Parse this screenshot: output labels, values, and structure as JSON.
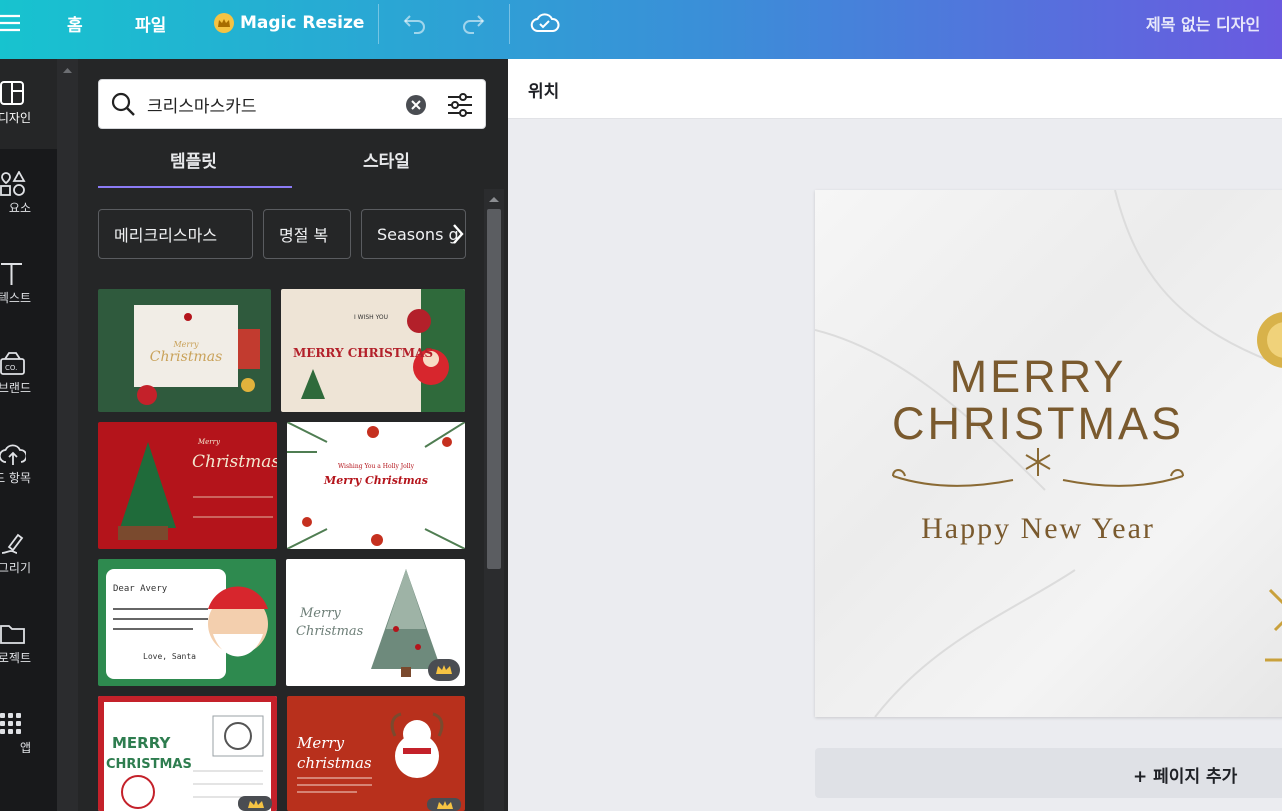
{
  "topbar": {
    "home": "홈",
    "file": "파일",
    "magic_resize": "Magic Resize",
    "title": "제목 없는 디자인"
  },
  "rail": [
    {
      "label": "디자인",
      "icon": "layout-icon"
    },
    {
      "label": "요소",
      "icon": "shapes-icon"
    },
    {
      "label": "텍스트",
      "icon": "text-icon"
    },
    {
      "label": "브랜드",
      "icon": "brand-icon"
    },
    {
      "label": "업로드 항목",
      "icon": "upload-icon"
    },
    {
      "label": "그리기",
      "icon": "draw-icon"
    },
    {
      "label": "프로젝트",
      "icon": "folder-icon"
    },
    {
      "label": "앱",
      "icon": "apps-icon"
    }
  ],
  "search": {
    "value": "크리스마스카드"
  },
  "tabs": {
    "templates": "템플릿",
    "styles": "스타일"
  },
  "chips": [
    "메리크리스마스",
    "명절 복",
    "Seasons g"
  ],
  "templates": [
    {
      "line1": "Merry",
      "line2": "Christmas",
      "bg": "#2f5a3d",
      "card": "#f1ede6",
      "accent": "#c9a25a"
    },
    {
      "line1": "I WISH YOU",
      "line2": "MERRY CHRISTMAS",
      "bg": "#eee4d6",
      "card": "#eee4d6",
      "accent": "#b3202a"
    },
    {
      "line1": "Merry",
      "line2": "Christmas",
      "bg": "#b4141b",
      "card": "#b4141b",
      "accent": "#f3e7d0"
    },
    {
      "line1": "Wishing You a Holly Jolly",
      "line2": "Merry Christmas",
      "bg": "#ffffff",
      "card": "#ffffff",
      "accent": "#b4141b"
    },
    {
      "line1": "Dear Avery",
      "line2": "Love, Santa",
      "bg": "#2e8a4f",
      "card": "#ffffff",
      "accent": "#b4141b"
    },
    {
      "line1": "Merry",
      "line2": "Christmas",
      "bg": "#ffffff",
      "card": "#ffffff",
      "accent": "#6e7f78"
    },
    {
      "line1": "MERRY",
      "line2": "CHRISTMAS",
      "bg": "#ffffff",
      "card": "#ffffff",
      "accent": "#2e7d4f"
    },
    {
      "line1": "Merry",
      "line2": "christmas",
      "bg": "#b8301c",
      "card": "#b8301c",
      "accent": "#ffffff"
    }
  ],
  "canvas": {
    "page_title": "위치",
    "headline1": "MERRY",
    "headline2": "CHRISTMAS",
    "subline": "Happy New Year",
    "add_page": "+ 페이지 추가",
    "text_color": "#7a5a2e"
  }
}
